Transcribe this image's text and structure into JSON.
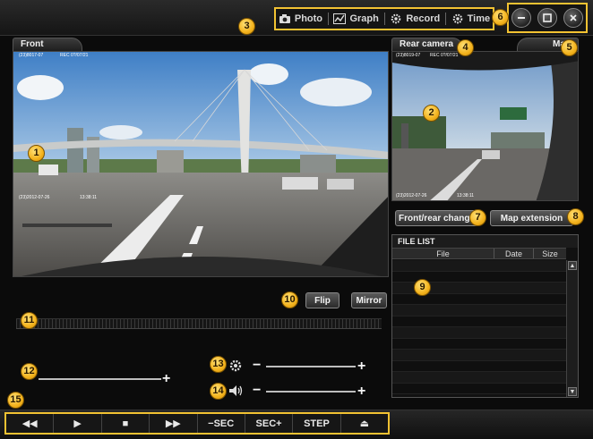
{
  "menu": {
    "photo": "Photo",
    "graph": "Graph",
    "record": "Record",
    "time": "Time"
  },
  "panels": {
    "front_camera": "Front camera",
    "rear_camera": "Rear camera",
    "map": "Map"
  },
  "overlays": {
    "front_top_left": "(23)8017-07",
    "front_top_mid": "REC 0?/07/21",
    "front_bottom_left": "(23)2012-07-26",
    "front_bottom_right": "13:38:11",
    "rear_top_left": "(23)8019-07",
    "rear_top_mid": "REC 0?/07/21",
    "rear_bottom_left": "(23)2012-07-26",
    "rear_bottom_right": "13:38:11"
  },
  "buttons": {
    "front_rear_change": "Front/rear change",
    "map_extension": "Map extension",
    "flip": "Flip",
    "mirror": "Mirror"
  },
  "file_list": {
    "title": "FILE LIST",
    "columns": [
      "File",
      "Date",
      "Size"
    ],
    "row_count": 12
  },
  "controls": {
    "rewind": "◀◀",
    "play": "▶",
    "stop": "■",
    "fast_forward": "▶▶",
    "minus_sec": "−SEC",
    "plus_sec": "SEC+",
    "step": "STEP",
    "eject": "⏏"
  },
  "sliders": {
    "minus": "−",
    "plus": "+"
  },
  "badges": [
    "1",
    "2",
    "3",
    "4",
    "5",
    "6",
    "7",
    "8",
    "9",
    "10",
    "11",
    "12",
    "13",
    "14",
    "15"
  ],
  "colors": {
    "accent_highlight": "#f2c232",
    "badge": "#f3b21c",
    "background": "#0b0b0b"
  }
}
